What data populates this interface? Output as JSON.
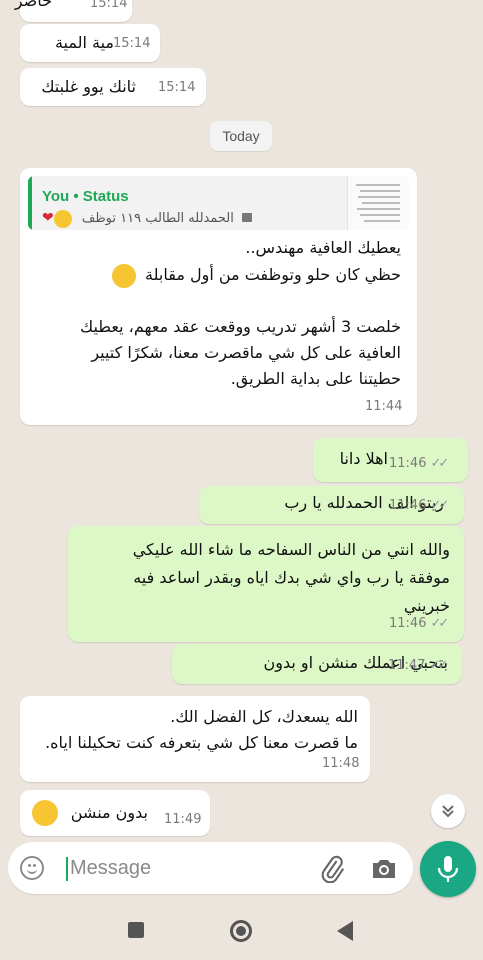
{
  "messages": [
    {
      "direction": "in",
      "text": "حاضر",
      "time": "15:14"
    },
    {
      "direction": "in",
      "text": "مية المية",
      "time": "15:14"
    },
    {
      "direction": "in",
      "text": "ثانك يوو غلبتك",
      "time": "15:14"
    },
    {
      "direction": "in",
      "quote_author": "You • Status",
      "quote_text": "الحمدلله الطالب ١١٩ توظف",
      "text_line1": "يعطيك العافية مهندس..",
      "text_line2": "حظي كان حلو وتوظفت من أول مقابلة",
      "text_line3": "خلصت 3 أشهر تدريب ووقعت عقد معهم، يعطيك\nالعافية على كل شي ماقصرت معنا، شكرًا كتيير\nحطيتنا على بداية الطريق.",
      "time": "11:44"
    },
    {
      "direction": "out",
      "text": "اهلا دانا",
      "time": "11:46",
      "status": "read"
    },
    {
      "direction": "out",
      "text": "ريتو الف الحمدلله يا رب",
      "time": "11:46",
      "status": "read"
    },
    {
      "direction": "out",
      "text": "والله انتي من الناس السفاحه ما شاء الله عليكي\nموفقة يا رب واي شي بدك اياه وبقدر اساعد فيه\nخبريني",
      "time": "11:46",
      "status": "read"
    },
    {
      "direction": "out",
      "text": "بتحبي اعملك منشن او بدون",
      "time": "11:47",
      "status": "read"
    },
    {
      "direction": "in",
      "text": "الله يسعدك، كل الفضل الك.\nما قصرت معنا كل شي بتعرفه كنت تحكيلنا اياه.",
      "time": "11:48"
    },
    {
      "direction": "in",
      "text": "بدون منشن",
      "time": "11:49"
    }
  ],
  "date_separator": "Today",
  "input": {
    "placeholder": "Message"
  },
  "icons": {
    "emoji": "smiley-icon",
    "attach": "paperclip-icon",
    "camera": "camera-icon",
    "mic": "microphone-icon",
    "scroll": "double-chevron-down-icon",
    "ticks": "double-check-icon"
  },
  "colors": {
    "background": "#ece5dd",
    "outgoing": "#dcf8c6",
    "incoming": "#ffffff",
    "accent": "#1aa884",
    "quote_bar": "#1fa855"
  }
}
